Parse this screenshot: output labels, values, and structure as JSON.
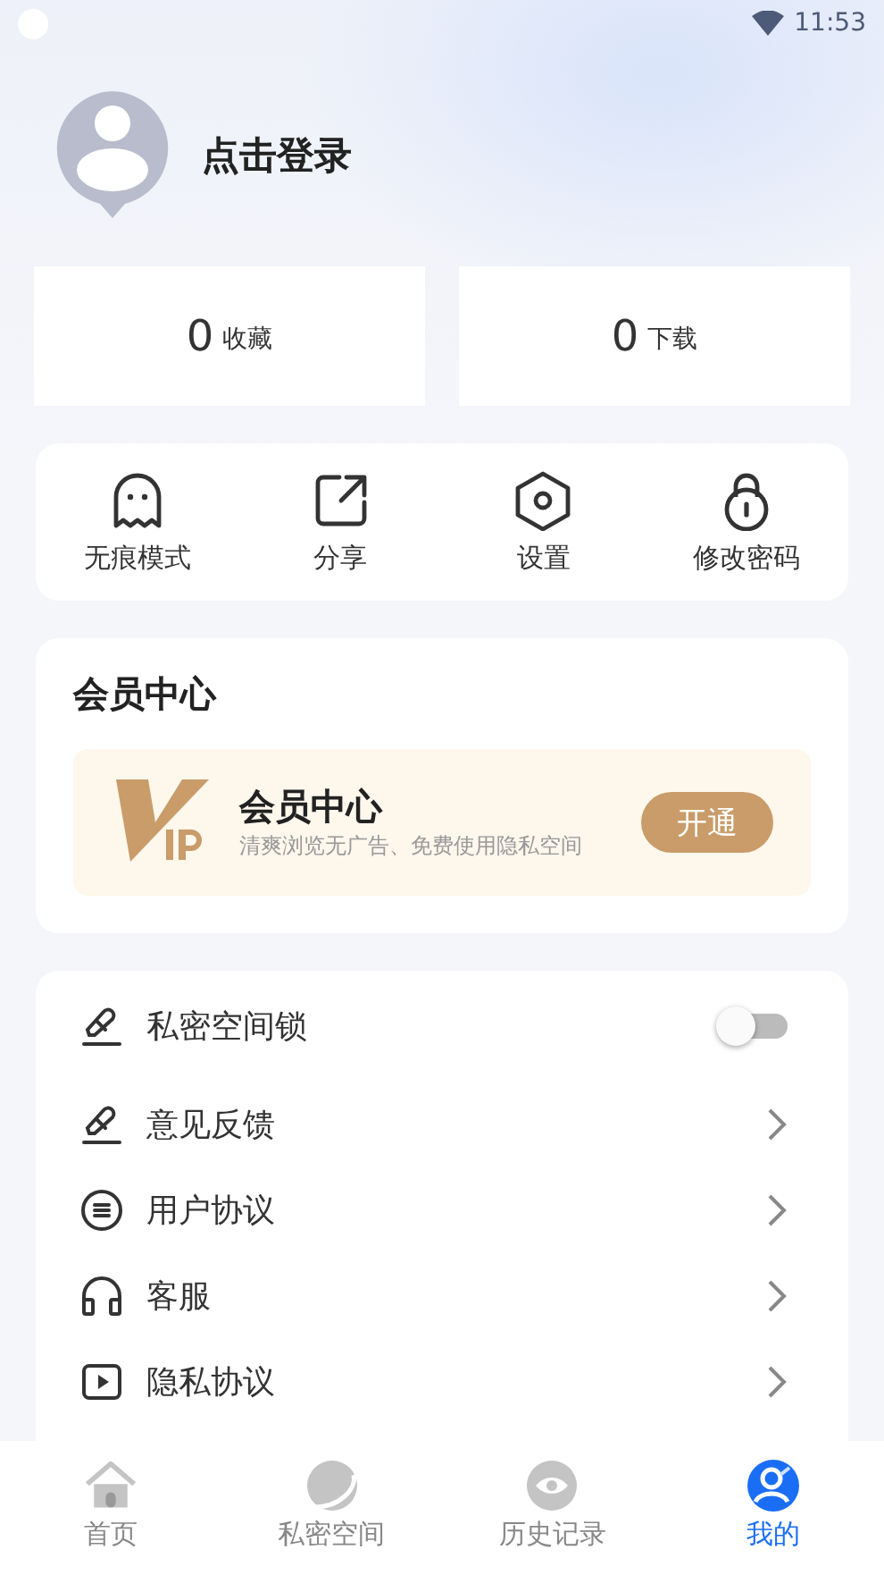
{
  "status_bar": {
    "time": "11:53"
  },
  "profile": {
    "login_label": "点击登录"
  },
  "stats": [
    {
      "count": "0",
      "label": "收藏"
    },
    {
      "count": "0",
      "label": "下载"
    }
  ],
  "shortcuts": [
    {
      "kind": "ghost",
      "label": "无痕模式"
    },
    {
      "kind": "share",
      "label": "分享"
    },
    {
      "kind": "settings",
      "label": "设置"
    },
    {
      "kind": "lock",
      "label": "修改密码"
    }
  ],
  "member_center": {
    "title": "会员中心",
    "banner_title": "会员中心",
    "banner_subtitle": "清爽浏览无广告、免费使用隐私空间",
    "button": "开通"
  },
  "settings_list": [
    {
      "kind": "toggle",
      "label": "私密空间锁",
      "on": false
    },
    {
      "kind": "link",
      "label": "意见反馈"
    },
    {
      "kind": "link",
      "label": "用户协议"
    },
    {
      "kind": "link",
      "label": "客服"
    },
    {
      "kind": "link",
      "label": "隐私协议"
    }
  ],
  "bottom_nav": [
    {
      "label": "首页",
      "selected": false
    },
    {
      "label": "私密空间",
      "selected": false
    },
    {
      "label": "历史记录",
      "selected": false
    },
    {
      "label": "我的",
      "selected": true
    }
  ]
}
